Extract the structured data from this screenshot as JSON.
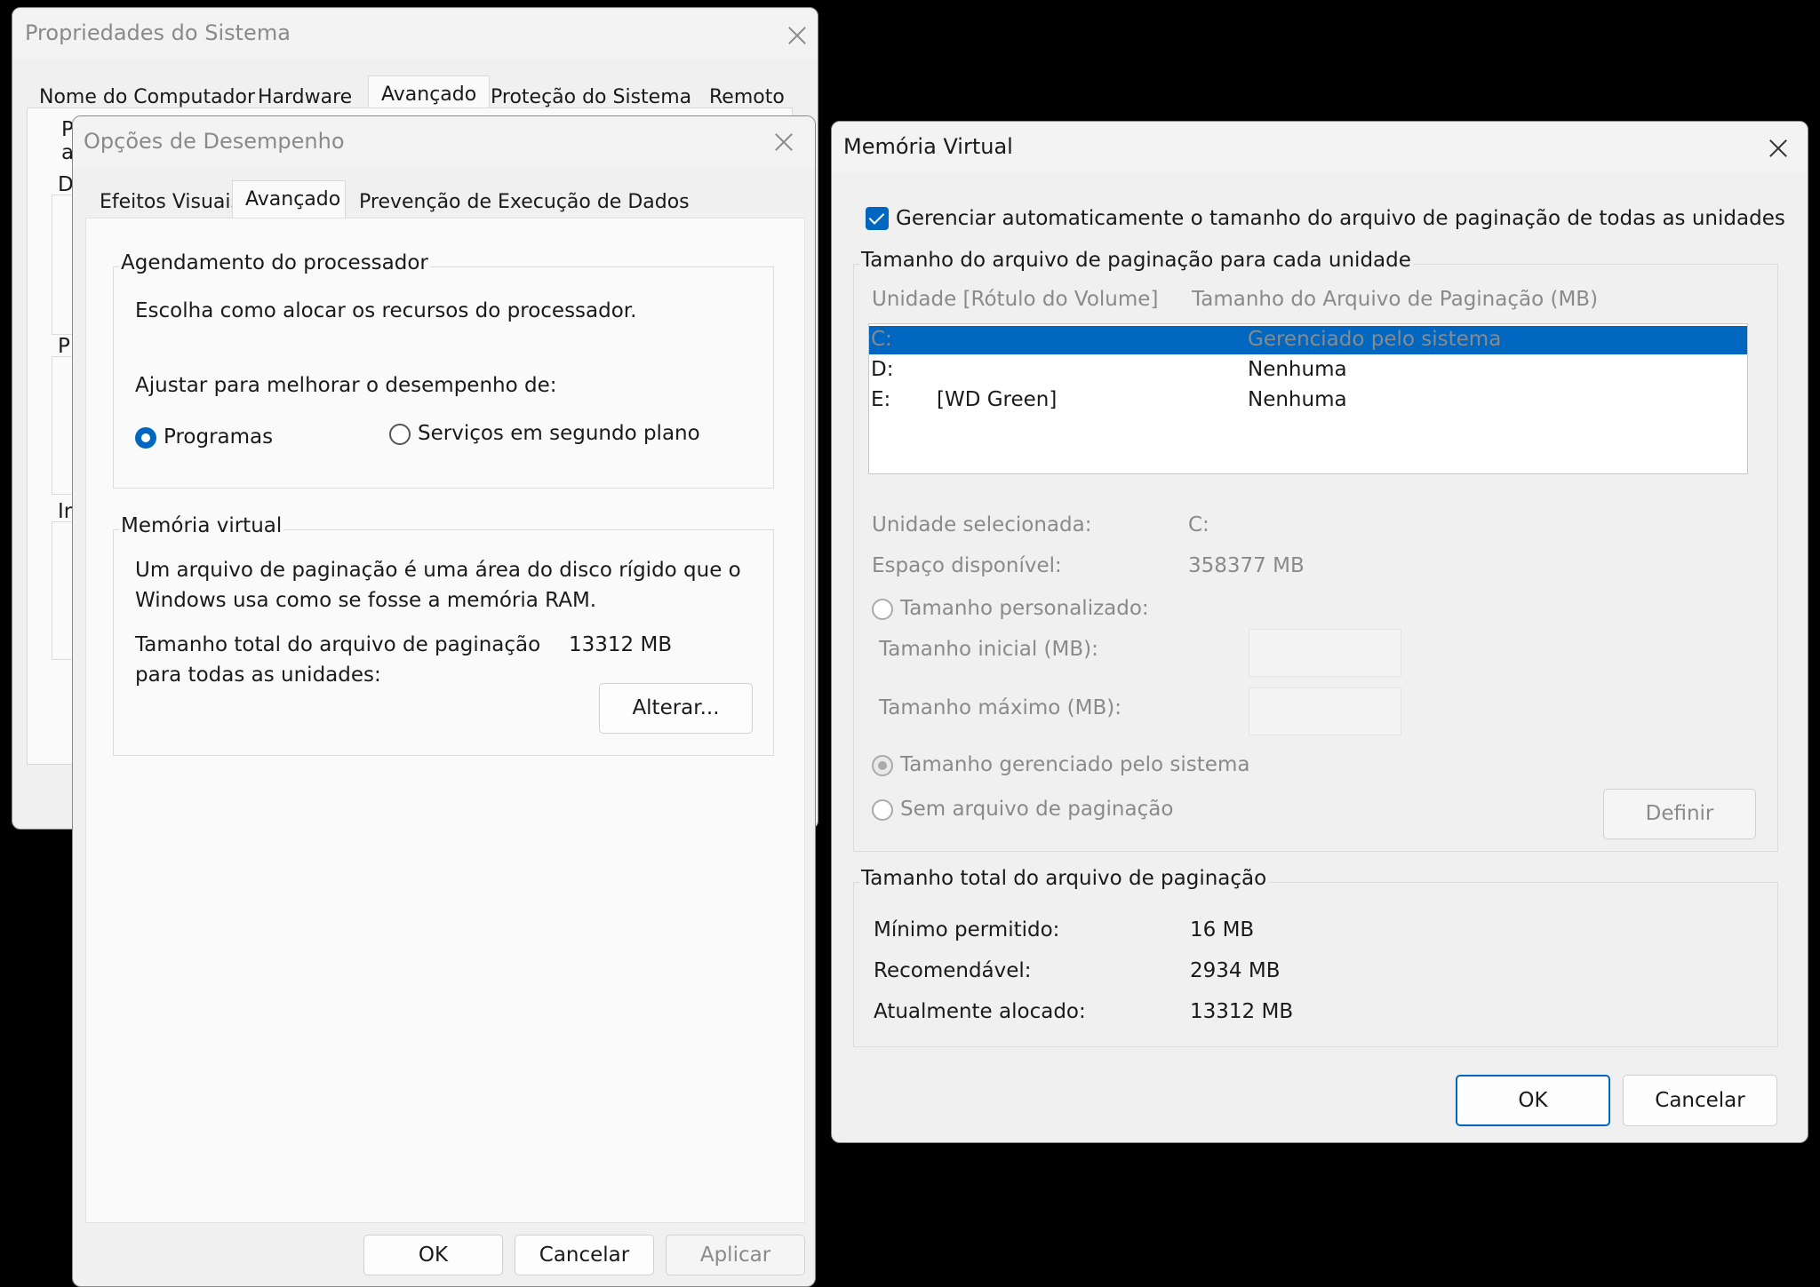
{
  "system_properties": {
    "title": "Propriedades do Sistema",
    "tabs": [
      "Nome do Computador",
      "Hardware",
      "Avançado",
      "Proteção do Sistema",
      "Remoto"
    ],
    "peek_letters": [
      "P",
      "a",
      "D",
      "P",
      "In"
    ]
  },
  "performance_options": {
    "title": "Opções de Desempenho",
    "tabs": [
      "Efeitos Visuais",
      "Avançado",
      "Prevenção de Execução de Dados"
    ],
    "scheduling": {
      "label": "Agendamento do processador",
      "description": "Escolha como alocar os recursos do processador.",
      "adjust_label": "Ajustar para melhorar o desempenho de:",
      "option_programs": "Programas",
      "option_services": "Serviços em segundo plano"
    },
    "virtual_memory": {
      "label": "Memória virtual",
      "description_line1": "Um arquivo de paginação é uma área do disco rígido que o",
      "description_line2": "Windows usa como se fosse a memória RAM.",
      "total_label_line1": "Tamanho total do arquivo de paginação",
      "total_label_line2": "para todas as unidades:",
      "total_value": "13312 MB",
      "change_button": "Alterar..."
    },
    "buttons": {
      "ok": "OK",
      "cancel": "Cancelar",
      "apply": "Aplicar"
    }
  },
  "virtual_memory_dialog": {
    "title": "Memória Virtual",
    "auto_manage_label": "Gerenciar automaticamente o tamanho do arquivo de paginação de todas as unidades",
    "per_drive_label": "Tamanho do arquivo de paginação para cada unidade",
    "columns": {
      "drive": "Unidade [Rótulo do Volume]",
      "size": "Tamanho do Arquivo de Paginação (MB)"
    },
    "drives": [
      {
        "letter": "C:",
        "label": "",
        "size": "Gerenciado pelo sistema"
      },
      {
        "letter": "D:",
        "label": "",
        "size": "Nenhuma"
      },
      {
        "letter": "E:",
        "label": "[WD Green]",
        "size": "Nenhuma"
      }
    ],
    "selected_drive_label": "Unidade selecionada:",
    "selected_drive_value": "C:",
    "free_space_label": "Espaço disponível:",
    "free_space_value": "358377 MB",
    "custom_size_label": "Tamanho personalizado:",
    "initial_size_label": "Tamanho inicial (MB):",
    "maximum_size_label": "Tamanho máximo (MB):",
    "system_managed_label": "Tamanho gerenciado pelo sistema",
    "no_paging_label": "Sem arquivo de paginação",
    "set_button": "Definir",
    "totals": {
      "label": "Tamanho total do arquivo de paginação",
      "min_label": "Mínimo permitido:",
      "min_value": "16 MB",
      "recommended_label": "Recomendável:",
      "recommended_value": "2934 MB",
      "allocated_label": "Atualmente alocado:",
      "allocated_value": "13312 MB"
    },
    "ok_button": "OK",
    "cancel_button": "Cancelar"
  }
}
